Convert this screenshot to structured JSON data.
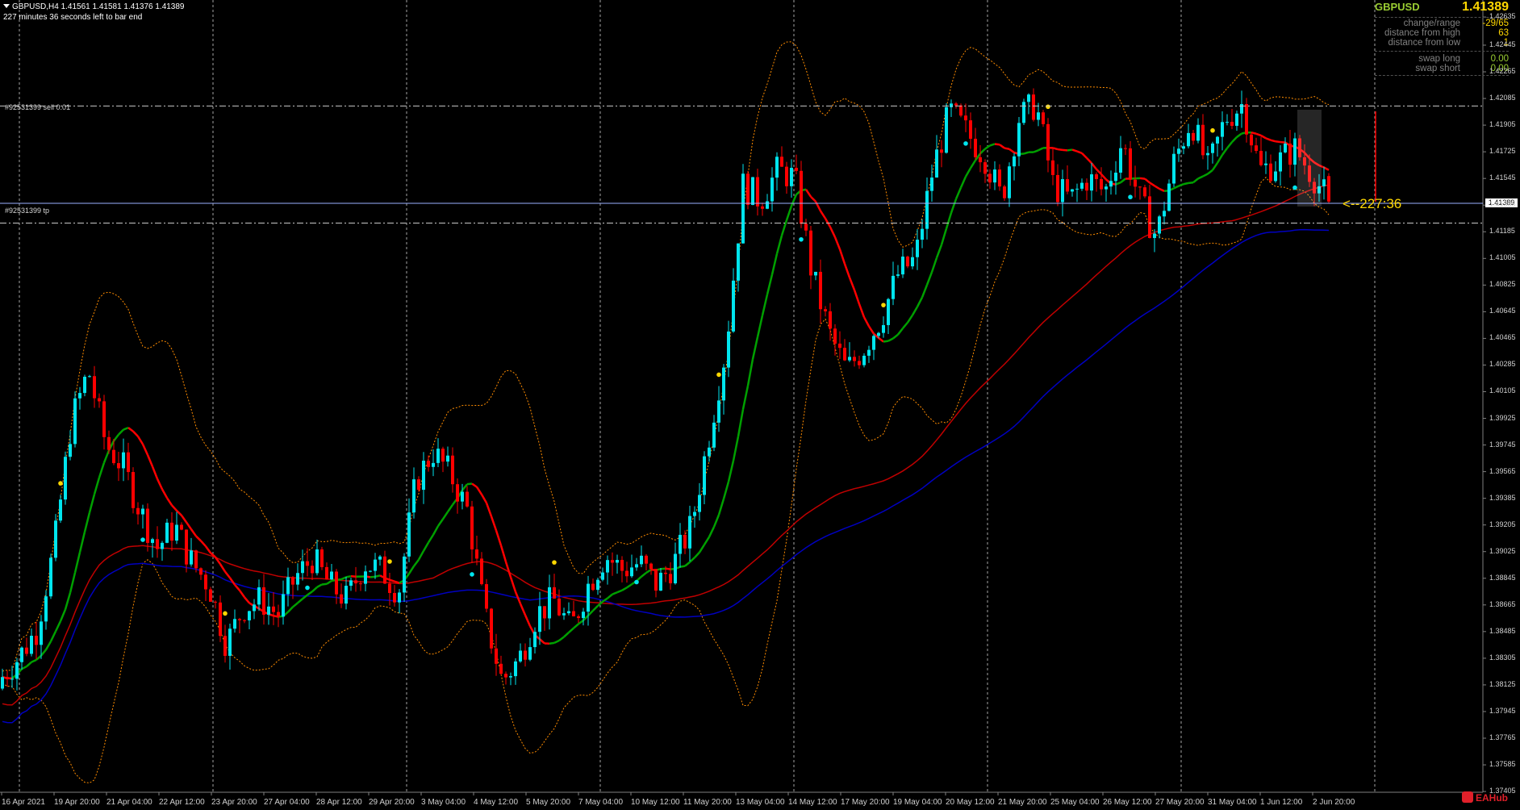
{
  "header": {
    "title": "GBPUSD,H4  1.41561 1.41581 1.41376 1.41389",
    "countdown_text": "227 minutes 36 seconds left to bar end"
  },
  "trade_lines": {
    "sell": {
      "label": "#92531399 sell 0.01",
      "price": 1.42034
    },
    "tp": {
      "label": "#92531399 tp",
      "price": 1.4132
    }
  },
  "info_panel": {
    "symbol": "GBPUSD",
    "price": "1.41389",
    "rows": [
      {
        "label": "change/range",
        "value": "-29/65",
        "green": false
      },
      {
        "label": "distance from high",
        "value": "63",
        "green": false
      },
      {
        "label": "distance from low",
        "value": "1",
        "green": false
      },
      {
        "label": "swap long",
        "value": "0.00",
        "green": true
      },
      {
        "label": "swap short",
        "value": "0.00",
        "green": true
      }
    ]
  },
  "timer_label": "<--227:36",
  "current_price_label": "1.41389",
  "brand": "EAHub",
  "colors": {
    "background": "#000000",
    "bull_candle": "#00e5ee",
    "bear_candle": "#ff0000",
    "ema_fast_up": "#00a000",
    "ema_fast_down": "#ff0000",
    "ema_slow": "#c00000",
    "ema_slower": "#0000c0",
    "bands": "#ff8c00",
    "grid": "#c0c0c0",
    "signal_yellow": "#ffd700",
    "signal_cyan": "#00e5ee"
  },
  "chart_data": {
    "type": "candlestick",
    "symbol": "GBPUSD",
    "timeframe": "H4",
    "ylim": [
      1.374,
      1.4275
    ],
    "y_ticks": [
      "1.42635",
      "1.42445",
      "1.42265",
      "1.42085",
      "1.41905",
      "1.41725",
      "1.41545",
      "1.41365",
      "1.41185",
      "1.41005",
      "1.40825",
      "1.40645",
      "1.40465",
      "1.40285",
      "1.40105",
      "1.39925",
      "1.39745",
      "1.39565",
      "1.39385",
      "1.39205",
      "1.39025",
      "1.38845",
      "1.38665",
      "1.38485",
      "1.38305",
      "1.38125",
      "1.37945",
      "1.37765",
      "1.37585",
      "1.37405"
    ],
    "x_ticks": [
      "16 Apr 2021",
      "19 Apr 20:00",
      "21 Apr 04:00",
      "22 Apr 12:00",
      "23 Apr 20:00",
      "27 Apr 04:00",
      "28 Apr 12:00",
      "29 Apr 20:00",
      "3 May 04:00",
      "4 May 12:00",
      "5 May 20:00",
      "7 May 04:00",
      "10 May 12:00",
      "11 May 20:00",
      "13 May 04:00",
      "14 May 12:00",
      "17 May 20:00",
      "19 May 04:00",
      "20 May 12:00",
      "21 May 20:00",
      "25 May 04:00",
      "26 May 12:00",
      "27 May 20:00",
      "31 May 04:00",
      "1 Jun 12:00",
      "2 Jun 20:00"
    ],
    "close_path": [
      1.3818,
      1.3832,
      1.385,
      1.3905,
      1.399,
      1.4025,
      1.3975,
      1.396,
      1.393,
      1.3905,
      1.392,
      1.3895,
      1.388,
      1.384,
      1.3865,
      1.387,
      1.386,
      1.3885,
      1.3898,
      1.388,
      1.387,
      1.3895,
      1.389,
      1.3875,
      1.395,
      1.397,
      1.3955,
      1.393,
      1.386,
      1.3815,
      1.383,
      1.386,
      1.387,
      1.385,
      1.388,
      1.39,
      1.389,
      1.3895,
      1.388,
      1.3895,
      1.392,
      1.398,
      1.404,
      1.415,
      1.414,
      1.416,
      1.4155,
      1.409,
      1.405,
      1.4025,
      1.404,
      1.406,
      1.409,
      1.41,
      1.416,
      1.42,
      1.4185,
      1.417,
      1.414,
      1.4195,
      1.4205,
      1.415,
      1.414,
      1.4155,
      1.4145,
      1.418,
      1.414,
      1.4115,
      1.4165,
      1.4195,
      1.416,
      1.4195,
      1.4205,
      1.416,
      1.4165,
      1.4175,
      1.4158,
      1.4139
    ],
    "last": {
      "open": 1.41561,
      "high": 1.41581,
      "low": 1.41376,
      "close": 1.41389
    }
  }
}
